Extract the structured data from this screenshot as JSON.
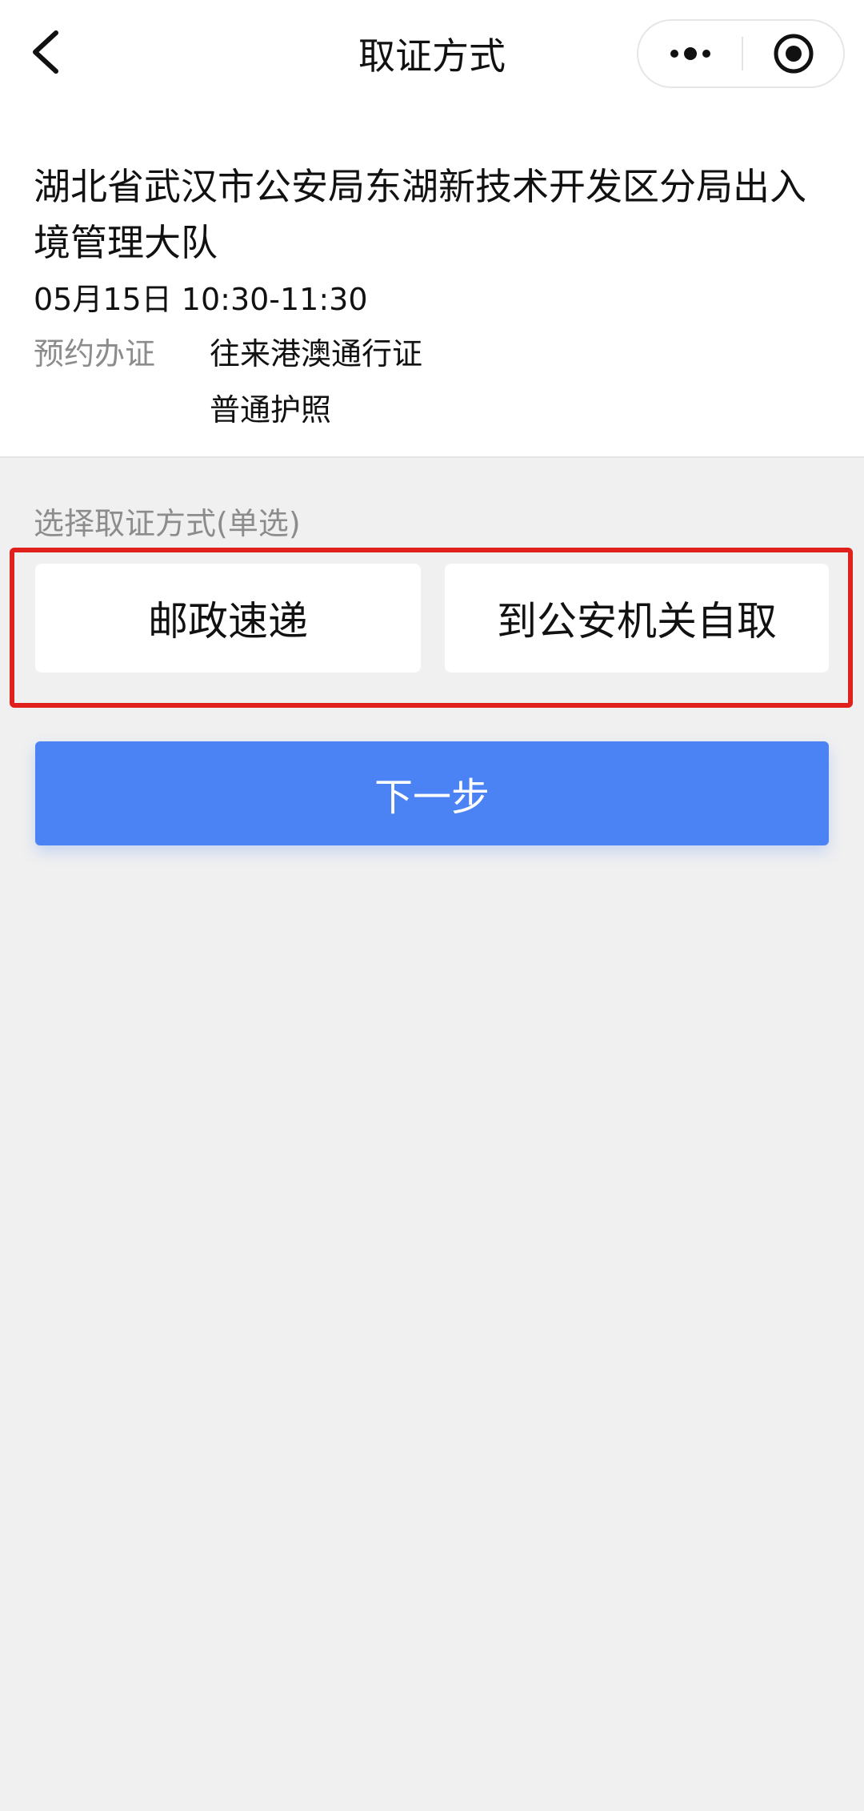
{
  "colors": {
    "primary_button": "#4b82f4",
    "highlight_frame": "#e0201d",
    "page_background": "#f0f0f0",
    "card_background": "#ffffff",
    "secondary_text": "#8c8c8c"
  },
  "nav": {
    "title": "取证方式",
    "back_icon": "chevron-left-icon",
    "more_icon": "more-dots-icon",
    "close_icon": "target-circle-icon"
  },
  "appointment": {
    "office_name": "湖北省武汉市公安局东湖新技术开发区分局出入境管理大队",
    "time": "05月15日 10:30-11:30",
    "service_label": "预约办证",
    "services": [
      "往来港澳通行证",
      "普通护照"
    ]
  },
  "pickup": {
    "section_label": "选择取证方式(单选)",
    "options": [
      "邮政速递",
      "到公安机关自取"
    ]
  },
  "actions": {
    "next_label": "下一步"
  }
}
